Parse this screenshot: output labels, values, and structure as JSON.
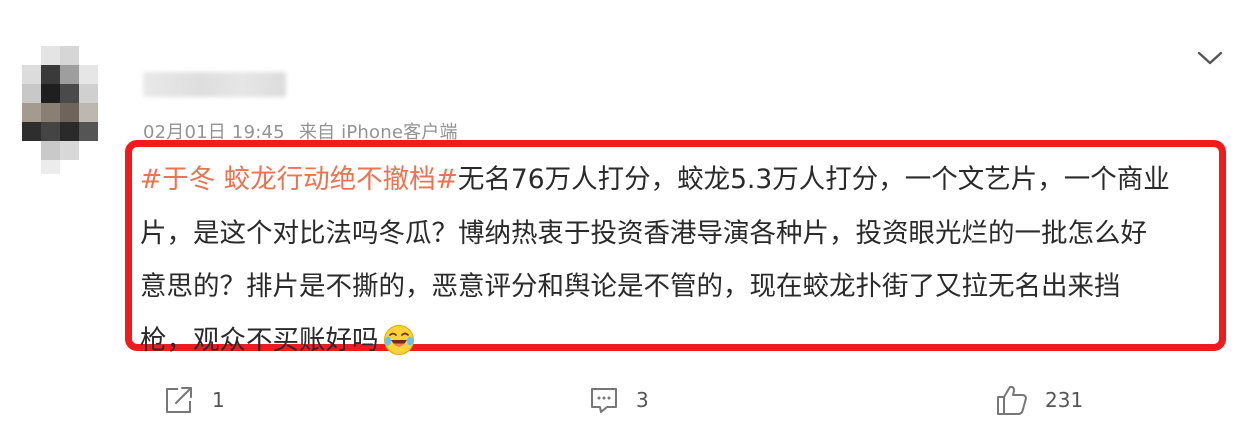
{
  "post": {
    "time": "02月01日 19:45",
    "source": "来自 iPhone客户端",
    "topic": "#于冬 蛟龙行动绝不撤档#",
    "body_lines": [
      "无名76万人打分，蛟龙5.3万人打分，一个文艺片，一个商业",
      "片，是这个对比法吗冬瓜？博纳热衷于投资香港导演各种片，投资眼光烂的一批怎么好",
      "意思的？排片是不撕的，恶意评分和舆论是不管的，现在蛟龙扑街了又拉无名出来挡",
      "枪，观众不买账好吗"
    ],
    "emoji": "laughing-crying-emoji"
  },
  "actions": {
    "share_count": "1",
    "comment_count": "3",
    "like_count": "231"
  },
  "colors": {
    "topic": "#eb7350",
    "highlight_border": "#ee1c1c",
    "meta_text": "#939393"
  }
}
